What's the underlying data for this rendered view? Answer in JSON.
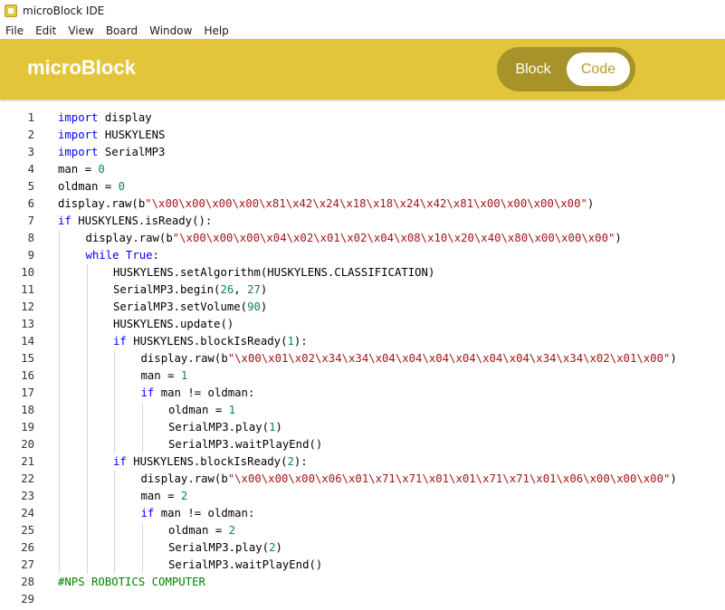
{
  "window": {
    "title": "microBlock IDE"
  },
  "menu": [
    "File",
    "Edit",
    "View",
    "Board",
    "Window",
    "Help"
  ],
  "header": {
    "brand": "microBlock",
    "toggle": {
      "block_label": "Block",
      "code_label": "Code",
      "active": "Code"
    }
  },
  "colors": {
    "header": "#e2c53a",
    "toggle_track": "#a8922a",
    "keyword": "#0000ff",
    "number": "#098658",
    "string": "#a31515",
    "comment": "#008000"
  },
  "editor": {
    "lines": [
      {
        "n": "1",
        "indent": 0,
        "tokens": [
          [
            "kw",
            "import"
          ],
          [
            "t",
            " display"
          ]
        ]
      },
      {
        "n": "2",
        "indent": 0,
        "tokens": [
          [
            "kw",
            "import"
          ],
          [
            "t",
            " HUSKYLENS"
          ]
        ]
      },
      {
        "n": "3",
        "indent": 0,
        "tokens": [
          [
            "kw",
            "import"
          ],
          [
            "t",
            " SerialMP3"
          ]
        ]
      },
      {
        "n": "4",
        "indent": 0,
        "tokens": [
          [
            "t",
            "man = "
          ],
          [
            "num",
            "0"
          ]
        ]
      },
      {
        "n": "5",
        "indent": 0,
        "tokens": [
          [
            "t",
            "oldman = "
          ],
          [
            "num",
            "0"
          ]
        ]
      },
      {
        "n": "6",
        "indent": 0,
        "tokens": [
          [
            "t",
            "display.raw(b"
          ],
          [
            "str",
            "\"\\x00\\x00\\x00\\x00\\x81\\x42\\x24\\x18\\x18\\x24\\x42\\x81\\x00\\x00\\x00\\x00\""
          ],
          [
            "t",
            ")"
          ]
        ]
      },
      {
        "n": "7",
        "indent": 0,
        "tokens": [
          [
            "kw",
            "if"
          ],
          [
            "t",
            " HUSKYLENS.isReady():"
          ]
        ]
      },
      {
        "n": "8",
        "indent": 1,
        "tokens": [
          [
            "t",
            "display.raw(b"
          ],
          [
            "str",
            "\"\\x00\\x00\\x00\\x04\\x02\\x01\\x02\\x04\\x08\\x10\\x20\\x40\\x80\\x00\\x00\\x00\""
          ],
          [
            "t",
            ")"
          ]
        ]
      },
      {
        "n": "9",
        "indent": 1,
        "tokens": [
          [
            "kw",
            "while True"
          ],
          [
            "t",
            ":"
          ]
        ]
      },
      {
        "n": "10",
        "indent": 2,
        "tokens": [
          [
            "t",
            "HUSKYLENS.setAlgorithm(HUSKYLENS.CLASSIFICATION)"
          ]
        ]
      },
      {
        "n": "11",
        "indent": 2,
        "tokens": [
          [
            "t",
            "SerialMP3.begin("
          ],
          [
            "num",
            "26"
          ],
          [
            "t",
            ", "
          ],
          [
            "num",
            "27"
          ],
          [
            "t",
            ")"
          ]
        ]
      },
      {
        "n": "12",
        "indent": 2,
        "tokens": [
          [
            "t",
            "SerialMP3.setVolume("
          ],
          [
            "num",
            "90"
          ],
          [
            "t",
            ")"
          ]
        ]
      },
      {
        "n": "13",
        "indent": 2,
        "tokens": [
          [
            "t",
            "HUSKYLENS.update()"
          ]
        ]
      },
      {
        "n": "14",
        "indent": 2,
        "tokens": [
          [
            "kw",
            "if"
          ],
          [
            "t",
            " HUSKYLENS.blockIsReady("
          ],
          [
            "num",
            "1"
          ],
          [
            "t",
            "):"
          ]
        ]
      },
      {
        "n": "15",
        "indent": 3,
        "tokens": [
          [
            "t",
            "display.raw(b"
          ],
          [
            "str",
            "\"\\x00\\x01\\x02\\x34\\x34\\x04\\x04\\x04\\x04\\x04\\x04\\x34\\x34\\x02\\x01\\x00\""
          ],
          [
            "t",
            ")"
          ]
        ]
      },
      {
        "n": "16",
        "indent": 3,
        "tokens": [
          [
            "t",
            "man = "
          ],
          [
            "num",
            "1"
          ]
        ]
      },
      {
        "n": "17",
        "indent": 3,
        "tokens": [
          [
            "kw",
            "if"
          ],
          [
            "t",
            " man != oldman:"
          ]
        ]
      },
      {
        "n": "18",
        "indent": 4,
        "tokens": [
          [
            "t",
            "oldman = "
          ],
          [
            "num",
            "1"
          ]
        ]
      },
      {
        "n": "19",
        "indent": 4,
        "tokens": [
          [
            "t",
            "SerialMP3.play("
          ],
          [
            "num",
            "1"
          ],
          [
            "t",
            ")"
          ]
        ]
      },
      {
        "n": "20",
        "indent": 4,
        "tokens": [
          [
            "t",
            "SerialMP3.waitPlayEnd()"
          ]
        ]
      },
      {
        "n": "21",
        "indent": 2,
        "tokens": [
          [
            "kw",
            "if"
          ],
          [
            "t",
            " HUSKYLENS.blockIsReady("
          ],
          [
            "num",
            "2"
          ],
          [
            "t",
            "):"
          ]
        ]
      },
      {
        "n": "22",
        "indent": 3,
        "tokens": [
          [
            "t",
            "display.raw(b"
          ],
          [
            "str",
            "\"\\x00\\x00\\x00\\x06\\x01\\x71\\x71\\x01\\x01\\x71\\x71\\x01\\x06\\x00\\x00\\x00\""
          ],
          [
            "t",
            ")"
          ]
        ]
      },
      {
        "n": "23",
        "indent": 3,
        "tokens": [
          [
            "t",
            "man = "
          ],
          [
            "num",
            "2"
          ]
        ]
      },
      {
        "n": "24",
        "indent": 3,
        "tokens": [
          [
            "kw",
            "if"
          ],
          [
            "t",
            " man != oldman:"
          ]
        ]
      },
      {
        "n": "25",
        "indent": 4,
        "tokens": [
          [
            "t",
            "oldman = "
          ],
          [
            "num",
            "2"
          ]
        ]
      },
      {
        "n": "26",
        "indent": 4,
        "tokens": [
          [
            "t",
            "SerialMP3.play("
          ],
          [
            "num",
            "2"
          ],
          [
            "t",
            ")"
          ]
        ]
      },
      {
        "n": "27",
        "indent": 4,
        "tokens": [
          [
            "t",
            "SerialMP3.waitPlayEnd()"
          ]
        ]
      },
      {
        "n": "28",
        "indent": 0,
        "tokens": [
          [
            "cmt",
            "#NPS ROBOTICS COMPUTER"
          ]
        ]
      },
      {
        "n": "29",
        "indent": 0,
        "tokens": []
      }
    ]
  }
}
